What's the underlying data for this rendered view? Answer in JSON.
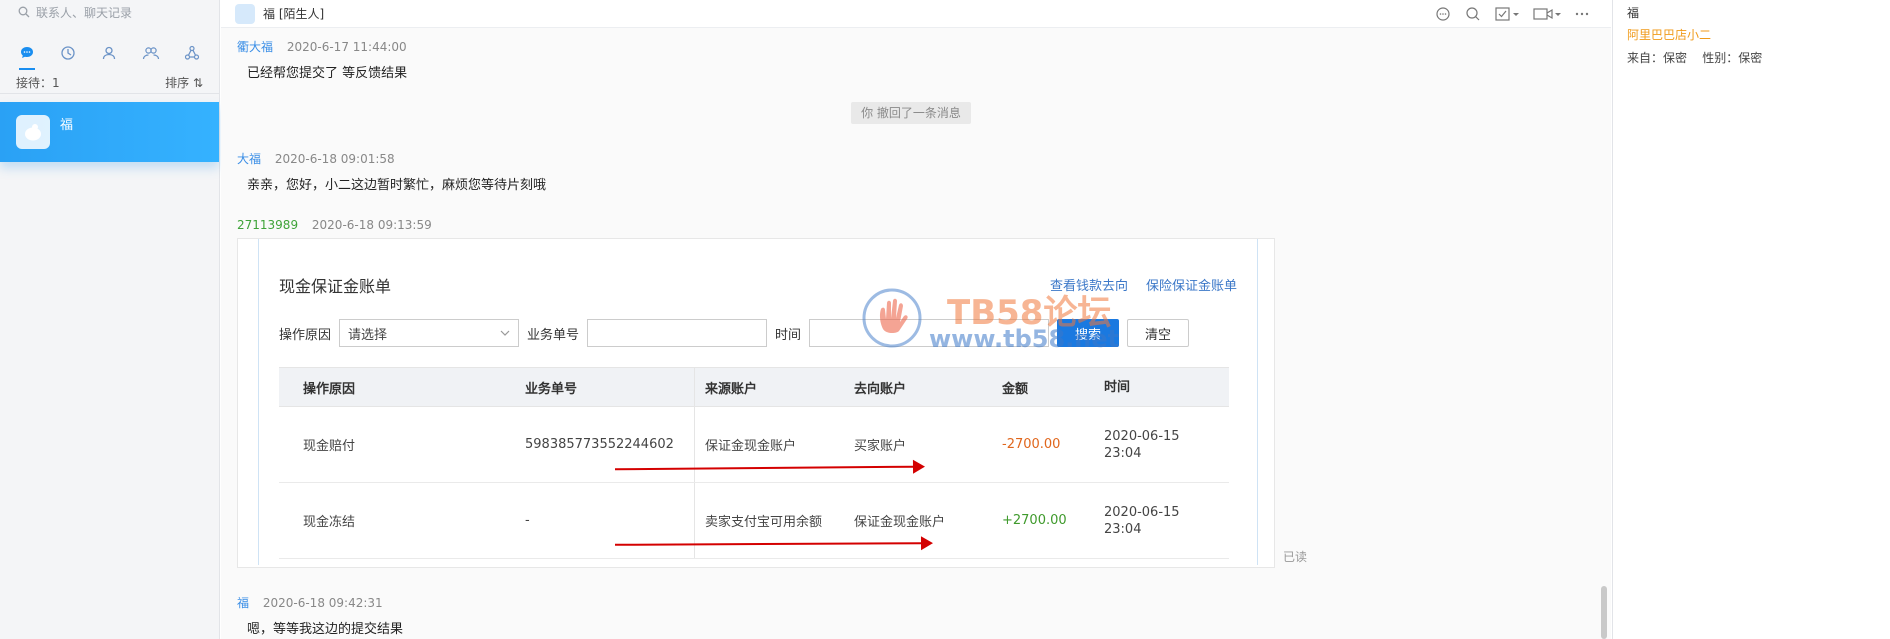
{
  "sidebar": {
    "search_placeholder": "联系人、聊天记录",
    "tabs": [
      "chat-icon",
      "history-icon",
      "contact-icon",
      "group-icon",
      "network-icon"
    ],
    "reception_label": "接待：1",
    "sort_label": "排序 ⇅",
    "active_conversation": {
      "name": "福"
    }
  },
  "chat": {
    "header": {
      "title": "福 [陌生人]"
    },
    "messages": [
      {
        "sender": "衢大福",
        "time": "2020-6-17 11:44:00",
        "text": "已经帮您提交了  等反馈结果"
      },
      {
        "system": "你 撤回了一条消息"
      },
      {
        "sender": "大福",
        "time": "2020-6-18 09:01:58",
        "text": "亲亲，您好，小二这边暂时繁忙，麻烦您等待片刻哦"
      },
      {
        "sender": "27113989",
        "time": "2020-6-18 09:13:59"
      },
      {
        "sender": "福",
        "time": "2020-6-18 09:42:31",
        "text": "嗯，等等我这边的提交结果"
      }
    ],
    "read_label": "已读"
  },
  "card": {
    "title": "现金保证金账单",
    "links": [
      "查看钱款去向",
      "保险保证金账单"
    ],
    "filter": {
      "reason_label": "操作原因",
      "reason_value": "请选择",
      "order_label": "业务单号",
      "time_label": "时间",
      "search_btn": "搜索",
      "clear_btn": "清空"
    },
    "watermark": {
      "line1": "TB58论坛",
      "line2": "www.tb58.net"
    },
    "table": {
      "headers": [
        "操作原因",
        "业务单号",
        "来源账户",
        "去向账户",
        "金额",
        "时间"
      ],
      "rows": [
        {
          "reason": "现金赔付",
          "order": "598385773552244602",
          "from": "保证金现金账户",
          "to": "买家账户",
          "amount": "-2700.00",
          "date": "2020-06-15",
          "clock": "23:04"
        },
        {
          "reason": "现金冻结",
          "order": "-",
          "from": "卖家支付宝可用余额",
          "to": "保证金现金账户",
          "amount": "+2700.00",
          "date": "2020-06-15",
          "clock": "23:04"
        }
      ]
    }
  },
  "right_panel": {
    "name": "福",
    "shop": "阿里巴巴店小二",
    "info": "来自：保密    性别：保密"
  },
  "colors": {
    "accent": "#2aa1f5",
    "negative": "#e0661c",
    "positive": "#3f9a2c",
    "arrow": "#d40000"
  }
}
